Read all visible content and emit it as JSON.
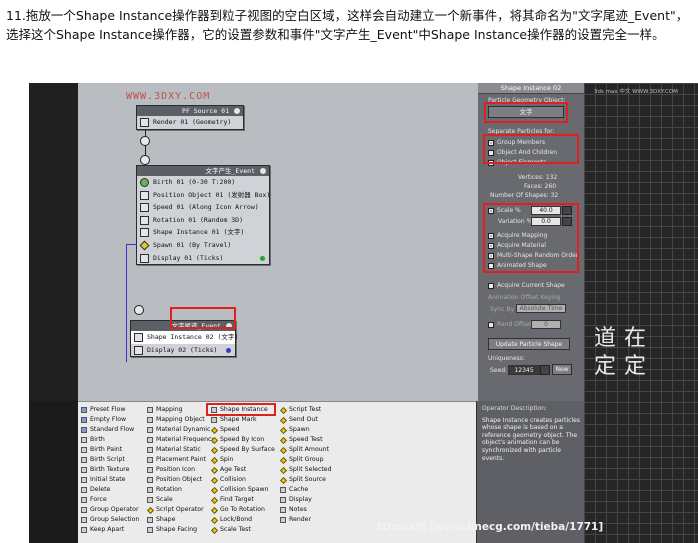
{
  "instruction": "11.拖放一个Shape Instance操作器到粒子视图的空白区域，这样会自动建立一个新事件，将其命名为\"文字尾迹_Event\"，选择这个Shape Instance操作器，它的设置参数和事件\"文字产生_Event\"中Shape Instance操作器的设置完全一样。",
  "watermark": "WWW.3DXY.COM",
  "source_event": {
    "title": "PF Source 01",
    "operators": [
      "Render 01 (Geometry)"
    ]
  },
  "event1": {
    "title": "文字产生_Event",
    "operators": [
      "Birth 01 (0-30 T:200)",
      "Position Object 01 (发射器 Box)",
      "Speed 01 (Along Icon Arrow)",
      "Rotation 01 (Random 3D)",
      "Shape Instance 01 (文字)",
      "Spawn 01 (By Travel)",
      "Display 01 (Ticks)"
    ]
  },
  "event2": {
    "title": "文字尾迹_Event",
    "operators": [
      "Shape Instance 02 (文字)",
      "Display 02 (Ticks)"
    ]
  },
  "panel": {
    "title": "Shape Instance 02",
    "geometry_label": "Particle Geometry Object:",
    "geometry_value": "文字",
    "separate_label": "Separate Particles for:",
    "group_members": "Group Members",
    "object_children": "Object And Children",
    "object_elements": "Object Elements",
    "vertices": "Vertices: 132",
    "faces": "Faces: 260",
    "num_shapes": "Number Of Shapes: 32",
    "scale_label": "Scale %",
    "scale_value": "40.0",
    "variation_label": "Variation %",
    "variation_value": "0.0",
    "acquire_mapping": "Acquire Mapping",
    "acquire_material": "Acquire Material",
    "multi_shape": "Multi-Shape Random Order",
    "animated_shape": "Animated Shape",
    "acquire_current": "Acquire Current Shape",
    "anim_offset": "Animation Offset Keying",
    "sync_by": "Sync By",
    "sync_value": "Absolute Time",
    "rand_offset": "Rand Offset",
    "rand_value": "0",
    "update_button": "Update Particle Shape",
    "uniqueness": "Uniqueness:",
    "seed_label": "Seed:",
    "seed_value": "12345",
    "new_button": "New"
  },
  "depot": {
    "col1": [
      "Preset Flow",
      "Empty Flow",
      "Standard Flow",
      "Birth",
      "Birth Paint",
      "Birth Script",
      "Birth Texture",
      "Initial State",
      "Delete",
      "Force",
      "Group Operator",
      "Group Selection",
      "Keep Apart"
    ],
    "col2": [
      "Mapping",
      "Mapping Object",
      "Material Dynamic",
      "Material Frequency",
      "Material Static",
      "Placement Paint",
      "Position Icon",
      "Position Object",
      "Rotation",
      "Scale",
      "Script Operator",
      "Shape",
      "Shape Facing"
    ],
    "col3": [
      "Shape Instance",
      "Shape Mark",
      "Speed",
      "Speed By Icon",
      "Speed By Surface",
      "Spin",
      "Age Test",
      "Collision",
      "Collision Spawn",
      "Find Target",
      "Go To Rotation",
      "Lock/Bond",
      "Scale Test"
    ],
    "col4": [
      "Script Test",
      "Send Out",
      "Spawn",
      "Speed Test",
      "Split Amount",
      "Split Group",
      "Split Selected",
      "Split Source",
      "Cache",
      "Display",
      "Notes",
      "Render"
    ]
  },
  "description": {
    "title": "Operator Description:",
    "text": "Shape Instance creates particles whose shape is based on a reference geometry object. The object's animation can be synchronized with particle events."
  },
  "viewport": {
    "label": "3ds max 中文 WWW.3DXY.COM",
    "chars": [
      "道",
      "在",
      "定",
      "定"
    ]
  },
  "footer_watermark": "3Dmax吧  [www.linecg.com/tieba/1771]",
  "colors": {
    "highlight": "#e02020",
    "canvas": "#b9bcc1",
    "panel": "#686a70"
  }
}
